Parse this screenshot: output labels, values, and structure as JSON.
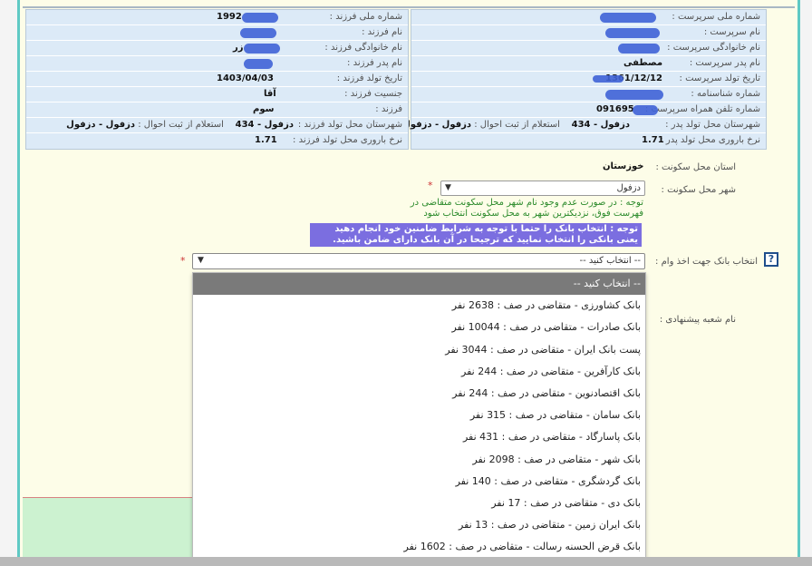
{
  "colors": {
    "panel_bg": "#dceaf7",
    "page_bg": "#fdfde8",
    "accent_border": "#5fc9c4",
    "note_green": "#2a8a2a",
    "warning_bg": "#7b6ee0",
    "selected_option_bg": "#7a7a7a"
  },
  "guardian": {
    "national_id_label": "شماره ملی سرپرست :",
    "first_name_label": "نام سرپرست :",
    "last_name_label": "نام خانوادگی سرپرست :",
    "father_name_label": "نام پدر سرپرست :",
    "father_name_value": "مصطفی",
    "birth_date_label": "تاریخ تولد سرپرست :",
    "birth_date_value": "1361/12/12",
    "id_number_label": "شماره شناسنامه :",
    "phone_label": "شماره تلفن همراه سرپرست :",
    "phone_value": "091695",
    "birth_city_label": "شهرستان محل تولد پدر :",
    "birth_city_value": "دزفول - 434",
    "registry_label": "استعلام از ثبت احوال :",
    "registry_value": "دزفول - دزفول",
    "fertility_label": "نرخ باروری محل تولد پدر :",
    "fertility_value": "1.71"
  },
  "child": {
    "national_id_label": "شماره ملی فرزند :",
    "national_id_value": "1992",
    "first_name_label": "نام فرزند :",
    "last_name_label": "نام خانوادگی فرزند :",
    "last_name_value": "زر",
    "father_name_label": "نام پدر فرزند :",
    "birth_date_label": "تاریخ تولد فرزند :",
    "birth_date_value": "1403/04/03",
    "gender_label": "جنسیت فرزند :",
    "gender_value": "آقا",
    "order_label": "فرزند :",
    "order_value": "سوم",
    "birth_city_label": "شهرستان محل تولد فرزند :",
    "birth_city_value": "دزفول - 434",
    "registry_label": "استعلام از ثبت احوال :",
    "registry_value": "دزفول - دزفول",
    "fertility_label": "نرخ باروری محل تولد فرزند :",
    "fertility_value": "1.71"
  },
  "form": {
    "province_label": "استان محل سکونت :",
    "province_value": "خوزستان",
    "city_label": "شهر محل سکونت :",
    "city_selected": "دزفول",
    "required_mark": "*",
    "city_note": "توجه : در صورت عدم وجود نام شهر محل سکونت متقاضی در فهرست فوق، نزدیکترین شهر به محل سکونت انتخاب شود",
    "bank_warning": "توجه : انتخاب بانک را حتما با توجه به شرایط ضامنین خود انجام دهید یعنی بانکی را انتخاب نمایید که ترجیحا در آن بانک دارای ضامن باشید.",
    "bank_label": "انتخاب بانک جهت اخذ وام :",
    "bank_selected": "-- انتخاب کنید --",
    "branch_label": "نام شعبه پیشنهادی :",
    "help_icon_glyph": "?"
  },
  "bank_options": [
    "-- انتخاب کنید --",
    "بانک کشاورزی - متقاضی در صف : 2638 نفر",
    "بانک صادرات - متقاضی در صف : 10044 نفر",
    "پست بانک ایران - متقاضی در صف : 3044 نفر",
    "بانک کارآفرین - متقاضی در صف : 244 نفر",
    "بانک اقتصادنوین - متقاضی در صف : 244 نفر",
    "بانک سامان - متقاضی در صف : 315 نفر",
    "بانک پاسارگاد - متقاضی در صف : 431 نفر",
    "بانک شهر - متقاضی در صف : 2098 نفر",
    "بانک گردشگری - متقاضی در صف : 140 نفر",
    "بانک دی - متقاضی در صف : 17 نفر",
    "بانک ایران زمین - متقاضی در صف : 13 نفر",
    "بانک قرض الحسنه رسالت - متقاضی در صف : 1602 نفر"
  ]
}
